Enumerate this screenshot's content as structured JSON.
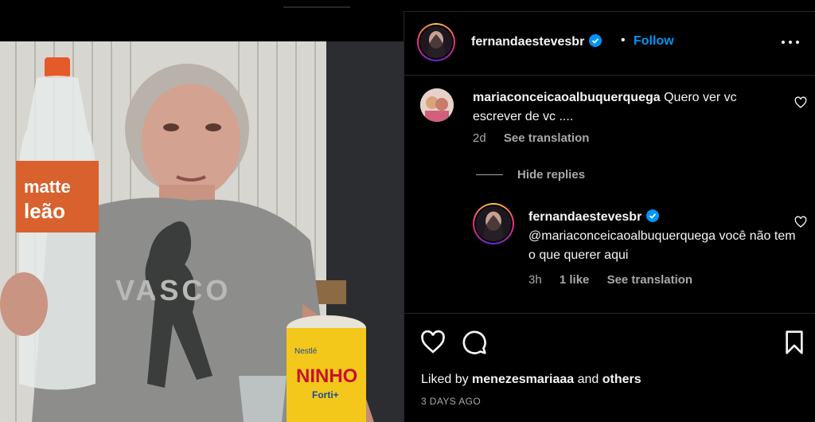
{
  "header": {
    "username": "fernandaestevesbr",
    "separator": "•",
    "follow_label": "Follow"
  },
  "comment": {
    "username": "mariaconceicaoalbuquerquega",
    "text": "Quero ver vc escrever de vc ....",
    "age": "2d",
    "translate_label": "See translation"
  },
  "hide_replies_label": "Hide replies",
  "reply": {
    "username": "fernandaestevesbr",
    "text": "@mariaconceicaoalbuquerquega você não tem o que querer aqui",
    "age": "3h",
    "likes": "1 like",
    "translate_label": "See translation"
  },
  "footer": {
    "liked_prefix": "Liked by",
    "liked_user": "menezesmariaaa",
    "liked_and": "and",
    "liked_others": "others",
    "posted": "3 DAYS AGO"
  },
  "photo": {
    "bottle_brand_top": "matte",
    "bottle_brand_bottom": "leão",
    "shirt_text": "VASCO",
    "can_brand": "NINHO",
    "can_sub": "Forti+",
    "can_maker": "Nestlé"
  },
  "colors": {
    "accent": "#0095f6",
    "secondary_text": "#a8a8a8",
    "divider": "#262626"
  }
}
